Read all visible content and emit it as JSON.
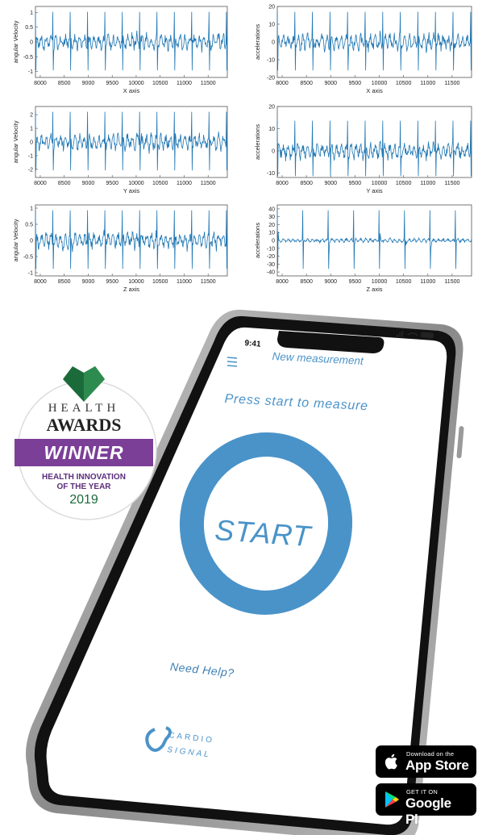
{
  "charts": {
    "chart_data": [
      {
        "type": "line",
        "panel": "angular-x",
        "xlabel": "X axis",
        "ylabel": "angular Velocity",
        "xticks": [
          8000,
          8500,
          9000,
          9500,
          10000,
          10500,
          11000,
          11500
        ],
        "xlim": [
          7900,
          11900
        ],
        "yticks": [
          -1,
          -0.5,
          0,
          0.5,
          1
        ],
        "ylim": [
          -1.2,
          1.2
        ]
      },
      {
        "type": "line",
        "panel": "angular-y",
        "xlabel": "Y axis",
        "ylabel": "angular Velocity",
        "xticks": [
          8000,
          8500,
          9000,
          9500,
          10000,
          10500,
          11000,
          11500
        ],
        "xlim": [
          7900,
          11900
        ],
        "yticks": [
          -2,
          -1,
          0,
          1,
          2
        ],
        "ylim": [
          -2.6,
          2.6
        ]
      },
      {
        "type": "line",
        "panel": "angular-z",
        "xlabel": "Z axis",
        "ylabel": "angular Velocity",
        "xticks": [
          8000,
          8500,
          9000,
          9500,
          10000,
          10500,
          11000,
          11500
        ],
        "xlim": [
          7900,
          11900
        ],
        "yticks": [
          -1,
          -0.5,
          0,
          0.5,
          1
        ],
        "ylim": [
          -1.1,
          1.1
        ]
      },
      {
        "type": "line",
        "panel": "accel-x",
        "xlabel": "X axis",
        "ylabel": "accelerations",
        "xticks": [
          8000,
          8500,
          9000,
          9500,
          10000,
          10500,
          11000,
          11500
        ],
        "xlim": [
          7900,
          11900
        ],
        "yticks": [
          -20,
          -10,
          0,
          10,
          20
        ],
        "ylim": [
          -20,
          20
        ]
      },
      {
        "type": "line",
        "panel": "accel-y",
        "xlabel": "Y axis",
        "ylabel": "accelerations",
        "xticks": [
          8000,
          8500,
          9000,
          9500,
          10000,
          10500,
          11000,
          11500
        ],
        "xlim": [
          7900,
          11900
        ],
        "yticks": [
          -10,
          0,
          10,
          20
        ],
        "ylim": [
          -12,
          20
        ]
      },
      {
        "type": "line",
        "panel": "accel-z",
        "xlabel": "Z axis",
        "ylabel": "accelerations",
        "xticks": [
          8000,
          8500,
          9000,
          9500,
          10000,
          10500,
          11000,
          11500
        ],
        "xlim": [
          7900,
          11900
        ],
        "yticks": [
          -40,
          -30,
          -20,
          -10,
          0,
          10,
          20,
          30,
          40
        ],
        "ylim": [
          -45,
          45
        ]
      }
    ]
  },
  "colors": {
    "line": "#1f77b4",
    "app_blue": "#4a93c9",
    "award_green": "#1b6b3a",
    "award_purple": "#7b3f98"
  },
  "phone": {
    "status_time": "9:41",
    "menu_icon": "hamburger-menu-icon",
    "header_title": "New measurement",
    "prompt": "Press start to measure",
    "start_label": "START",
    "help_link": "Need Help?",
    "logo_top": "CARDIO",
    "logo_bottom": "SIGNAL"
  },
  "award": {
    "line1": "HEALTH",
    "line2": "AWARDS",
    "banner": "WINNER",
    "category_line1": "HEALTH INNOVATION",
    "category_line2": "OF THE YEAR",
    "year": "2019"
  },
  "stores": {
    "apple_small": "Download on the",
    "apple_big": "App Store",
    "apple_icon": "apple-icon",
    "google_small": "GET IT ON",
    "google_big": "Google Play",
    "google_icon": "google-play-icon"
  }
}
